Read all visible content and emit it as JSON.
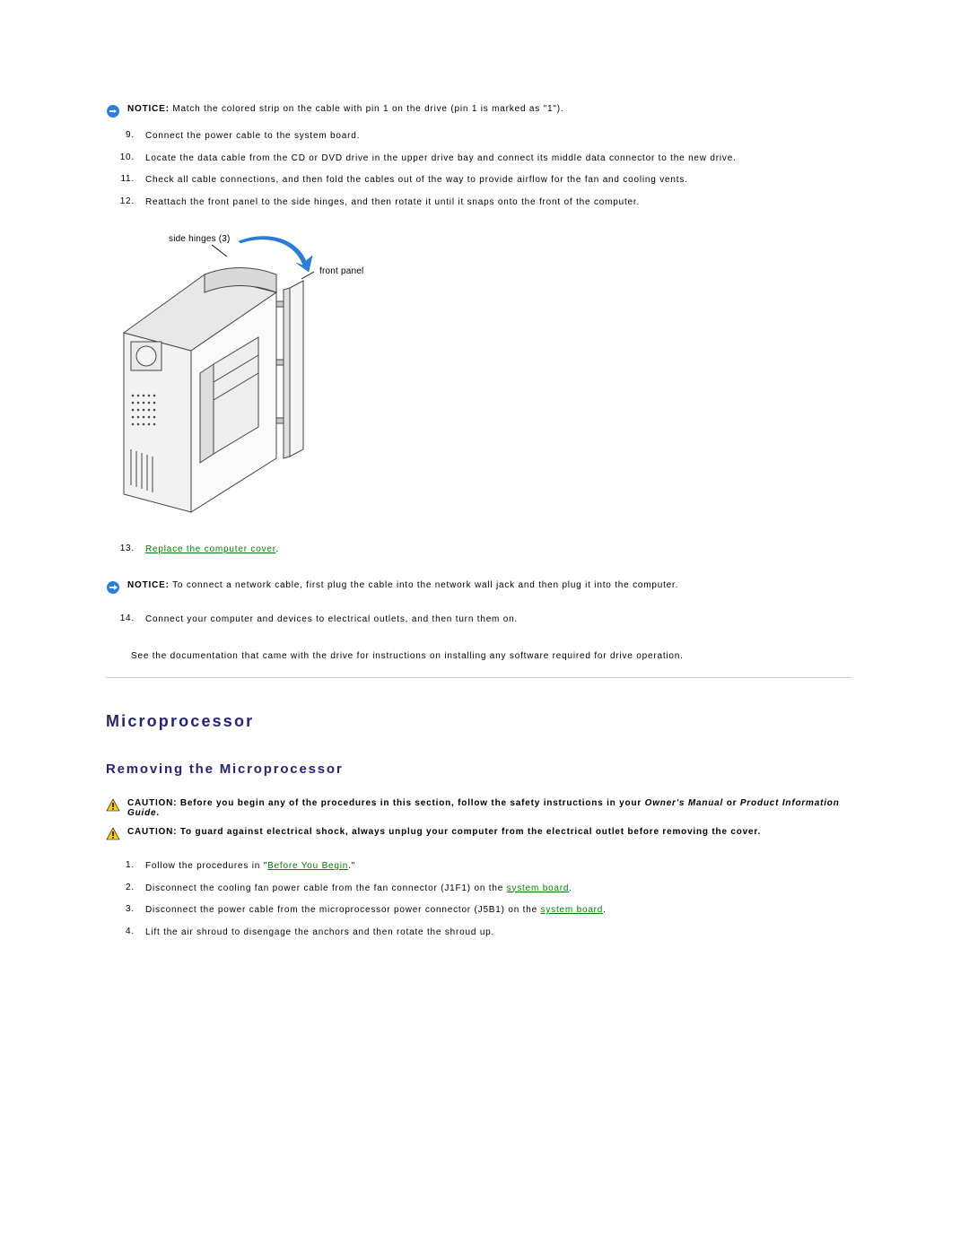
{
  "notice1": {
    "label": "NOTICE:",
    "text": "Match the colored strip on the cable with pin 1 on the drive (pin 1 is marked as \"1\")."
  },
  "steps_top": {
    "s9": {
      "num": "9.",
      "text": "Connect the power cable to the system board."
    },
    "s10": {
      "num": "10.",
      "text": "Locate the data cable from the CD or DVD drive in the upper drive bay and connect its middle data connector to the new drive."
    },
    "s11": {
      "num": "11.",
      "text": "Check all cable connections, and then fold the cables out of the way to provide airflow for the fan and cooling vents."
    },
    "s12": {
      "num": "12.",
      "text": "Reattach the front panel to the side hinges, and then rotate it until it snaps onto the front of the computer."
    }
  },
  "figure": {
    "callout1": "side hinges (3)",
    "callout2": "front panel"
  },
  "step13": {
    "num": "13.",
    "link": "Replace the computer cover",
    "tail": "."
  },
  "notice2": {
    "label": "NOTICE:",
    "text": "To connect a network cable, first plug the cable into the network wall jack and then plug it into the computer."
  },
  "step14": {
    "num": "14.",
    "text": "Connect your computer and devices to electrical outlets, and then turn them on."
  },
  "closing": "See the documentation that came with the drive for instructions on installing any software required for drive operation.",
  "h2": "Microprocessor",
  "h3": "Removing the Microprocessor",
  "caution1": {
    "label": "CAUTION:",
    "pre": "Before you begin any of the procedures in this section, follow the safety instructions in your ",
    "em1": "Owner's Manual",
    "mid": " or ",
    "em2": "Product Information Guide",
    "tail": "."
  },
  "caution2": {
    "label": "CAUTION:",
    "text": "To guard against electrical shock, always unplug your computer from the electrical outlet before removing the cover."
  },
  "steps_bottom": {
    "s1": {
      "num": "1.",
      "pre": "Follow the procedures in \"",
      "link": "Before You Begin",
      "tail": ".\""
    },
    "s2": {
      "num": "2.",
      "pre": "Disconnect the cooling fan power cable from the fan connector (J1F1) on the ",
      "link": "system board",
      "tail": "."
    },
    "s3": {
      "num": "3.",
      "pre": "Disconnect the power cable from the microprocessor power connector (J5B1) on the ",
      "link": "system board",
      "tail": "."
    },
    "s4": {
      "num": "4.",
      "text": "Lift the air shroud to disengage the anchors and then rotate the shroud up."
    }
  }
}
